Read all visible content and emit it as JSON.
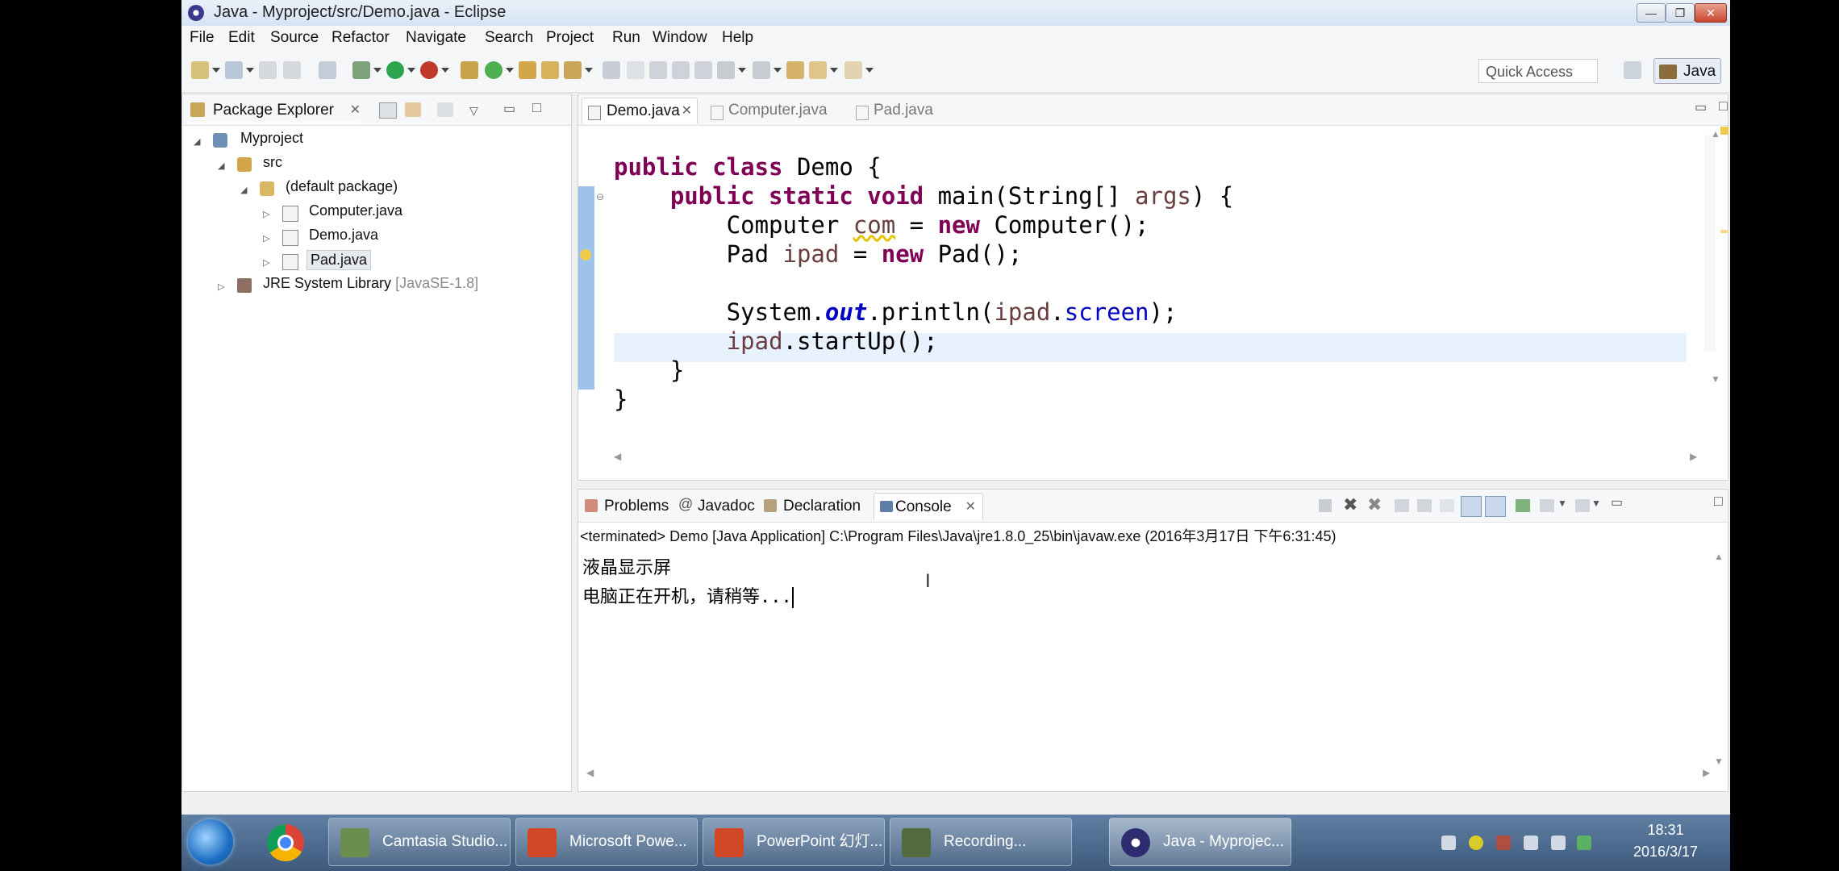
{
  "window": {
    "title": "Java - Myproject/src/Demo.java - Eclipse",
    "controls": [
      "—",
      "❐",
      "✕"
    ]
  },
  "menu": [
    "File",
    "Edit",
    "Source",
    "Refactor",
    "Navigate",
    "Search",
    "Project",
    "Run",
    "Window",
    "Help"
  ],
  "toolbar": {
    "quick_access": "Quick Access",
    "perspective": "Java"
  },
  "package_explorer": {
    "tab_label": "Package Explorer",
    "tree": {
      "project": "Myproject",
      "src": "src",
      "package": "(default package)",
      "files": [
        "Computer.java",
        "Demo.java",
        "Pad.java"
      ],
      "library": "JRE System Library",
      "library_version": "[JavaSE-1.8]"
    }
  },
  "editor": {
    "tabs": [
      "Demo.java",
      "Computer.java",
      "Pad.java"
    ],
    "active_tab": "Demo.java",
    "code_lines": [
      "public class Demo {",
      "    public static void main(String[] args) {",
      "        Computer com = new Computer();",
      "        Pad ipad = new Pad();",
      "",
      "        System.out.println(ipad.screen);",
      "        ipad.startUp();",
      "    }",
      "}"
    ]
  },
  "console": {
    "tabs": [
      "Problems",
      "Javadoc",
      "Declaration",
      "Console"
    ],
    "active_tab": "Console",
    "status": "<terminated> Demo [Java Application] C:\\Program Files\\Java\\jre1.8.0_25\\bin\\javaw.exe (2016年3月17日 下午6:31:45)",
    "output": [
      "液晶显示屏",
      "电脑正在开机，请稍等..."
    ]
  },
  "taskbar": {
    "items": [
      "Camtasia Studio...",
      "Microsoft Powe...",
      "PowerPoint 幻灯...",
      "Recording...",
      "Java - Myprojec..."
    ],
    "time": "18:31",
    "date": "2016/3/17"
  }
}
